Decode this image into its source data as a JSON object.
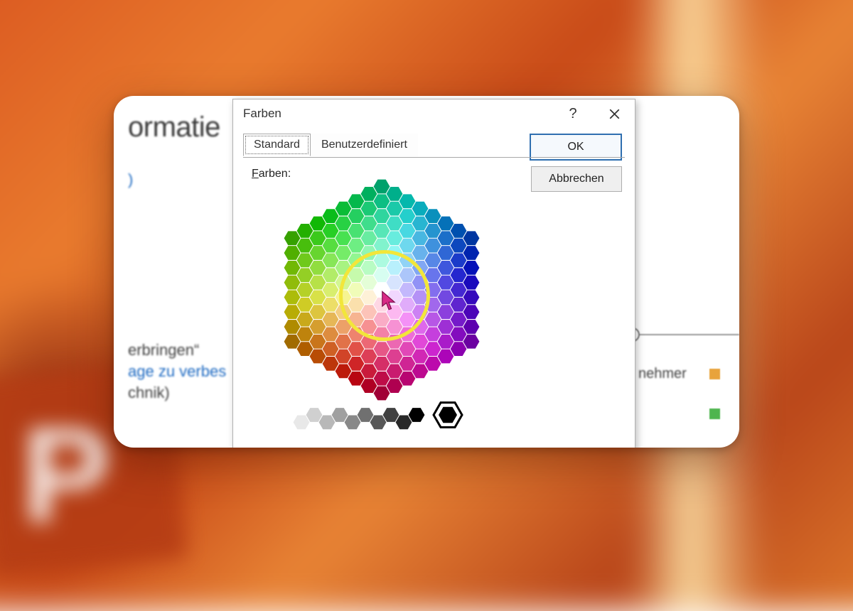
{
  "dialog": {
    "title": "Farben",
    "tabs": {
      "standard": "Standard",
      "custom": "Benutzerdefiniert"
    },
    "label_colors": "Farben:",
    "ok": "OK",
    "cancel": "Abbrechen",
    "help_symbol": "?"
  },
  "slide": {
    "heading_fragment": "ormatie",
    "blue_fragment_top": ")",
    "line1_fragment": "erbringen“",
    "line2_fragment_blue": "age zu verbes",
    "line3_fragment": "chnik)",
    "legend1_fragment": "nehmer"
  },
  "picker": {
    "ring_color": "#f2e63a",
    "cursor_color": "#c21b6d",
    "selected_gray": "#000000",
    "main_hex_colors": [
      "#00247d",
      "#0033a0",
      "#0047bb",
      "#1f5fd0",
      "#3b7ae0",
      "#5a94ee",
      "#7aaef7",
      "#003c2e",
      "#005a3c",
      "#008a4b",
      "#19b35e",
      "#4fcf77",
      "#86e39b",
      "#b9f0bc",
      "#3a4a00",
      "#5b6f00",
      "#7a9400",
      "#9cb900",
      "#bedb1f",
      "#d9ef62",
      "#edf7a8",
      "#5a3700",
      "#7a4a00",
      "#9c6200",
      "#c07e12",
      "#dd9b33",
      "#f2b85c",
      "#f9d492",
      "#6e0e00",
      "#8c1800",
      "#a92300",
      "#c7351a",
      "#de513a",
      "#ef7964",
      "#f7a495",
      "#5a0040",
      "#7a0059",
      "#9a0f78",
      "#b93498",
      "#d05bb5",
      "#e386cd",
      "#f1b2e1",
      "#2e0060",
      "#3e0a80",
      "#5320a4",
      "#6e3cc2",
      "#8b5fd9",
      "#aa86e9",
      "#c9aef4",
      "#ffffff"
    ],
    "gray_scale": [
      "#ffffff",
      "#e8e8e8",
      "#d0d0d0",
      "#b8b8b8",
      "#a0a0a0",
      "#888888",
      "#707070",
      "#585858",
      "#404040",
      "#282828",
      "#000000"
    ]
  }
}
